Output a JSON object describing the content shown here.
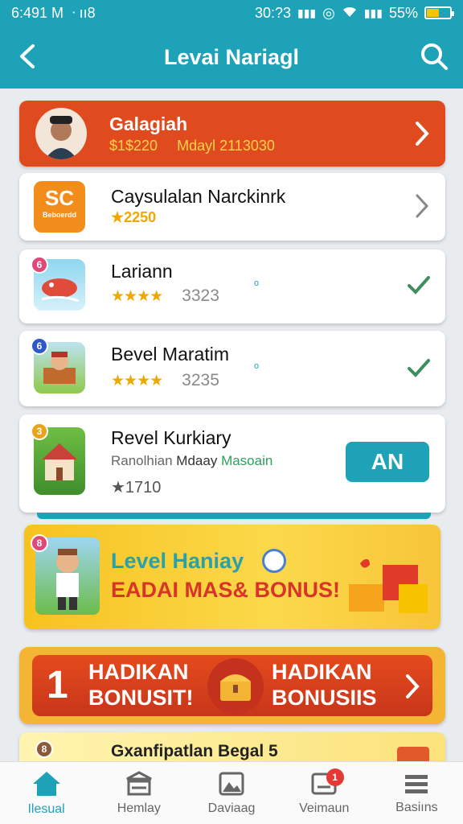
{
  "status_bar": {
    "time": "6:491 M",
    "left_extra": "ᐧ ıı8",
    "clock_right": "30:?3",
    "battery": "55%",
    "battery_level": 0.55
  },
  "header": {
    "title": "Levai Nariagl"
  },
  "items": [
    {
      "title": "Galagiah",
      "sub_left": "$1$220",
      "sub_right": "Mdayl 2113030",
      "thumb_text": ""
    },
    {
      "title": "Caysulalan Narckinrk",
      "rating_text": "★2250",
      "thumb_text": "SC",
      "thumb_caption": "Beboerdd"
    },
    {
      "title": "Lariann",
      "stars": "★★★★",
      "score": "3323",
      "badge": "6",
      "mini": "ᵒ"
    },
    {
      "title": "Bevel Maratim",
      "stars": "★★★★",
      "score": "3235",
      "badge": "6",
      "mini": "ᵒ"
    },
    {
      "title": "Revel Kurkiary",
      "subtitle_a": "Ranolhian",
      "subtitle_b": "Mdaay",
      "subtitle_c": "Masoain",
      "rating_text": "★1710",
      "badge": "3",
      "button_label": "AN"
    }
  ],
  "banner": {
    "line1": "Level Haniay",
    "line2": "EADAI MAS& BONUS!",
    "badge": "8"
  },
  "bonus": {
    "number": "1",
    "left_top": "HADIKAN",
    "left_bottom": "BONUSIT!",
    "right_top": "HADIKAN",
    "right_bottom": "BONUSIIS"
  },
  "partial_card": {
    "title": "Gxanfipatlan Begal 5",
    "badge": "8"
  },
  "nav": [
    {
      "label": "Ilesual",
      "icon": "home-icon"
    },
    {
      "label": "Hemlay",
      "icon": "library-icon"
    },
    {
      "label": "Daviaag",
      "icon": "gallery-icon"
    },
    {
      "label": "Veimaun",
      "icon": "inbox-icon",
      "badge": "1"
    },
    {
      "label": "Basiıns",
      "icon": "menu-icon"
    }
  ],
  "colors": {
    "primary": "#1ea2b8",
    "alert": "#e04a1f",
    "check": "#3d8f5f",
    "star": "#f0a800"
  }
}
